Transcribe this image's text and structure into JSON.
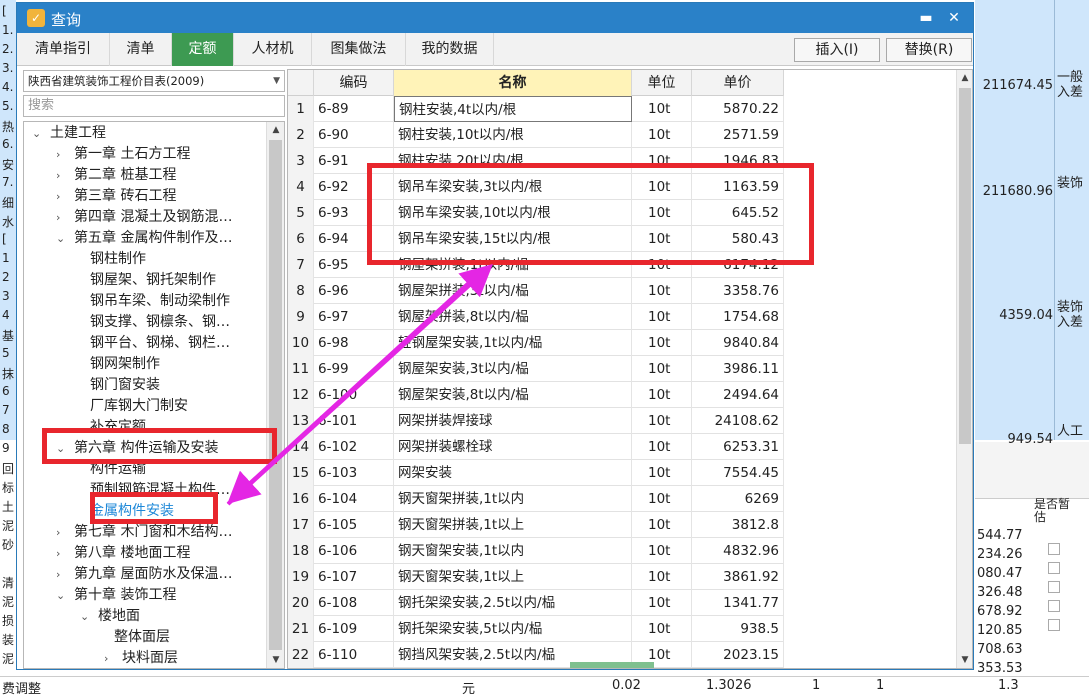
{
  "window": {
    "title": "查询",
    "minimize": "▬",
    "close": "✕"
  },
  "tabs": [
    "清单指引",
    "清单",
    "定额",
    "人材机",
    "图集做法",
    "我的数据"
  ],
  "actions": {
    "insert": "插入(I)",
    "replace": "替换(R)"
  },
  "library": {
    "selected": "陕西省建筑装饰工程价目表(2009)",
    "search_placeholder": "搜索"
  },
  "tree": [
    {
      "label": "土建工程",
      "level": 0,
      "expander": "⌄"
    },
    {
      "label": "第一章 土石方工程",
      "level": 1,
      "expander": "›"
    },
    {
      "label": "第二章 桩基工程",
      "level": 1,
      "expander": "›"
    },
    {
      "label": "第三章 砖石工程",
      "level": 1,
      "expander": "›"
    },
    {
      "label": "第四章 混凝土及钢筋混…",
      "level": 1,
      "expander": "›"
    },
    {
      "label": "第五章 金属构件制作及…",
      "level": 1,
      "expander": "⌄"
    },
    {
      "label": "钢柱制作",
      "level": 2,
      "expander": ""
    },
    {
      "label": "钢屋架、钢托架制作",
      "level": 2,
      "expander": ""
    },
    {
      "label": "钢吊车梁、制动梁制作",
      "level": 2,
      "expander": ""
    },
    {
      "label": "钢支撑、钢檩条、钢…",
      "level": 2,
      "expander": ""
    },
    {
      "label": "钢平台、钢梯、钢栏…",
      "level": 2,
      "expander": ""
    },
    {
      "label": "钢网架制作",
      "level": 2,
      "expander": ""
    },
    {
      "label": "钢门窗安装",
      "level": 2,
      "expander": ""
    },
    {
      "label": "厂库钢大门制安",
      "level": 2,
      "expander": ""
    },
    {
      "label": "补充定额",
      "level": 2,
      "expander": ""
    },
    {
      "label": "第六章 构件运输及安装",
      "level": 1,
      "expander": "⌄"
    },
    {
      "label": "构件运输",
      "level": 2,
      "expander": ""
    },
    {
      "label": "预制钢筋混凝土构件…",
      "level": 2,
      "expander": ""
    },
    {
      "label": "金属构件安装",
      "level": 2,
      "expander": "",
      "selected": true
    },
    {
      "label": "第七章 木门窗和木结构…",
      "level": 1,
      "expander": "›"
    },
    {
      "label": "第八章 楼地面工程",
      "level": 1,
      "expander": "›"
    },
    {
      "label": "第九章 屋面防水及保温…",
      "level": 1,
      "expander": "›"
    },
    {
      "label": "第十章 装饰工程",
      "level": 1,
      "expander": "⌄"
    },
    {
      "label": "楼地面",
      "level": 2,
      "expander": "⌄"
    },
    {
      "label": "整体面层",
      "level": 3,
      "expander": ""
    },
    {
      "label": "块料面层",
      "level": 3,
      "expander": "›"
    }
  ],
  "grid": {
    "headers": [
      "编码",
      "名称",
      "单位",
      "单价"
    ],
    "rows": [
      {
        "n": "1",
        "code": "6-89",
        "name": "钢柱安装,4t以内/根",
        "unit": "10t",
        "price": "5870.22"
      },
      {
        "n": "2",
        "code": "6-90",
        "name": "钢柱安装,10t以内/根",
        "unit": "10t",
        "price": "2571.59"
      },
      {
        "n": "3",
        "code": "6-91",
        "name": "钢柱安装,20t以内/根",
        "unit": "10t",
        "price": "1946.83"
      },
      {
        "n": "4",
        "code": "6-92",
        "name": "钢吊车梁安装,3t以内/根",
        "unit": "10t",
        "price": "1163.59"
      },
      {
        "n": "5",
        "code": "6-93",
        "name": "钢吊车梁安装,10t以内/根",
        "unit": "10t",
        "price": "645.52"
      },
      {
        "n": "6",
        "code": "6-94",
        "name": "钢吊车梁安装,15t以内/根",
        "unit": "10t",
        "price": "580.43"
      },
      {
        "n": "7",
        "code": "6-95",
        "name": "钢屋架拼装,1t以内/榀",
        "unit": "10t",
        "price": "6174.12"
      },
      {
        "n": "8",
        "code": "6-96",
        "name": "钢屋架拼装,3t以内/榀",
        "unit": "10t",
        "price": "3358.76"
      },
      {
        "n": "9",
        "code": "6-97",
        "name": "钢屋架拼装,8t以内/榀",
        "unit": "10t",
        "price": "1754.68"
      },
      {
        "n": "10",
        "code": "6-98",
        "name": "轻钢屋架安装,1t以内/榀",
        "unit": "10t",
        "price": "9840.84"
      },
      {
        "n": "11",
        "code": "6-99",
        "name": "钢屋架安装,3t以内/榀",
        "unit": "10t",
        "price": "3986.11"
      },
      {
        "n": "12",
        "code": "6-100",
        "name": "钢屋架安装,8t以内/榀",
        "unit": "10t",
        "price": "2494.64"
      },
      {
        "n": "13",
        "code": "6-101",
        "name": "网架拼装焊接球",
        "unit": "10t",
        "price": "24108.62"
      },
      {
        "n": "14",
        "code": "6-102",
        "name": "网架拼装螺栓球",
        "unit": "10t",
        "price": "6253.31"
      },
      {
        "n": "15",
        "code": "6-103",
        "name": "网架安装",
        "unit": "10t",
        "price": "7554.45"
      },
      {
        "n": "16",
        "code": "6-104",
        "name": "钢天窗架拼装,1t以内",
        "unit": "10t",
        "price": "6269"
      },
      {
        "n": "17",
        "code": "6-105",
        "name": "钢天窗架拼装,1t以上",
        "unit": "10t",
        "price": "3812.8"
      },
      {
        "n": "18",
        "code": "6-106",
        "name": "钢天窗架安装,1t以内",
        "unit": "10t",
        "price": "4832.96"
      },
      {
        "n": "19",
        "code": "6-107",
        "name": "钢天窗架安装,1t以上",
        "unit": "10t",
        "price": "3861.92"
      },
      {
        "n": "20",
        "code": "6-108",
        "name": "钢托架梁安装,2.5t以内/榀",
        "unit": "10t",
        "price": "1341.77"
      },
      {
        "n": "21",
        "code": "6-109",
        "name": "钢托架梁安装,5t以内/榀",
        "unit": "10t",
        "price": "938.5"
      },
      {
        "n": "22",
        "code": "6-110",
        "name": "钢挡风架安装,2.5t以内/榀",
        "unit": "10t",
        "price": "2023.15"
      }
    ]
  },
  "background": {
    "right_values": [
      "211674.45",
      "211680.96",
      "4359.04",
      "949.54"
    ],
    "right_labels": [
      "一般\n入差",
      "装饰",
      "装饰\n入差",
      "人工"
    ],
    "lower_values": [
      "544.77",
      "234.26",
      "080.47",
      "326.48",
      "678.92",
      "120.85",
      "708.63",
      "353.53"
    ],
    "lower_header": "是否暂估",
    "bottom_row": {
      "label": "费调整",
      "unit": "元",
      "v1": "0.02",
      "v2": "1.3026",
      "v3": "1",
      "v4": "1",
      "v5": "1.3"
    },
    "left_chars": [
      "[",
      "1.",
      "2.",
      "3.",
      "4.",
      "5.",
      "热",
      "6.",
      "安",
      "7.",
      "细",
      "水",
      "[",
      "1",
      "2",
      "3",
      "4",
      "基",
      "5",
      "抹",
      "6",
      "7",
      "8",
      "9",
      "回",
      "标",
      "土",
      "泥",
      "砂",
      "",
      "清",
      "泥",
      "损",
      "装",
      "泥"
    ]
  }
}
